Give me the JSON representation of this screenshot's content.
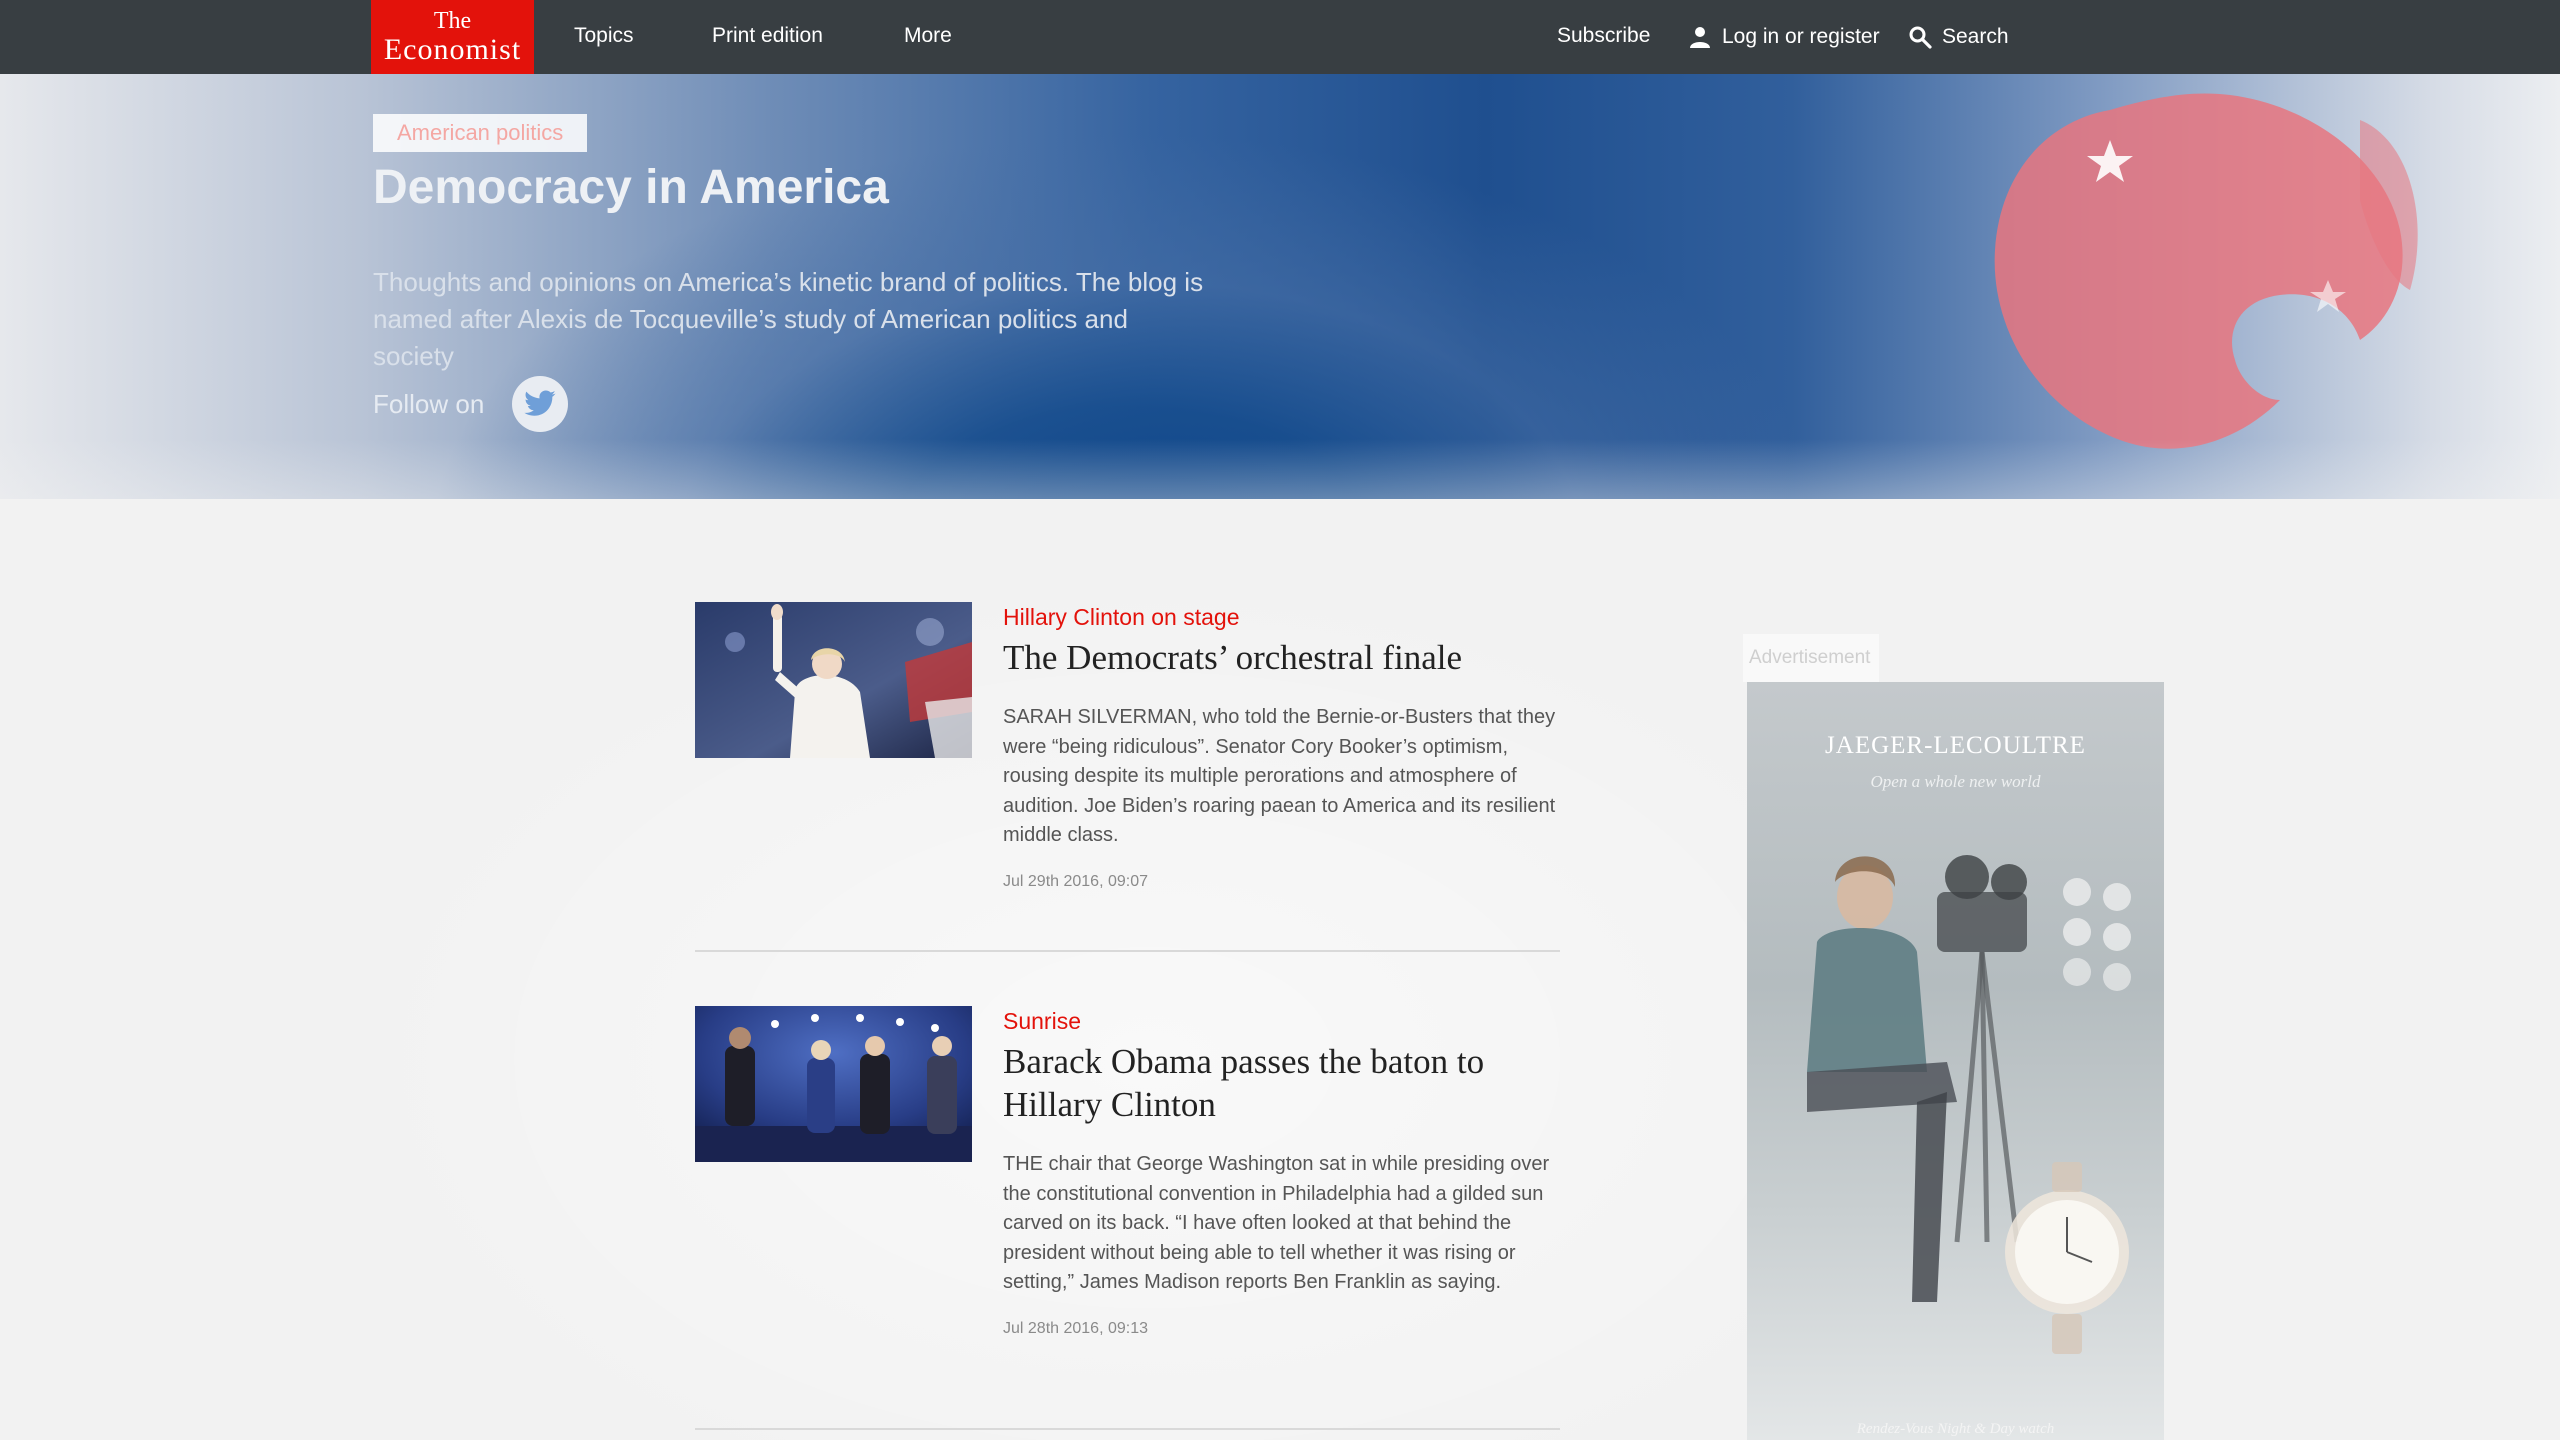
{
  "nav": {
    "logo_line1": "The",
    "logo_line2": "Economist",
    "topics": "Topics",
    "print_edition": "Print edition",
    "more": "More",
    "subscribe": "Subscribe",
    "login": "Log in or register",
    "search": "Search"
  },
  "hero": {
    "tag": "American politics",
    "title": "Democracy in America",
    "description": "Thoughts and opinions on America’s kinetic brand of politics. The blog is named after Alexis de Tocqueville’s study of American politics and society",
    "follow_label": "Follow on"
  },
  "articles": [
    {
      "kicker": "Hillary Clinton on stage",
      "headline": "The Democrats’ orchestral finale",
      "summary": "SARAH SILVERMAN, who told the Bernie-or-Busters that they were “being ridiculous”. Senator Cory Booker’s optimism, rousing despite its multiple perorations and atmosphere of audition. Joe Biden’s roaring paean to America and its resilient middle class.",
      "date": "Jul 29th 2016, 09:07"
    },
    {
      "kicker": "Sunrise",
      "headline": "Barack Obama passes the baton to Hillary Clinton",
      "summary": "THE chair that George Washington sat in while presiding over the constitutional convention in Philadelphia had a gilded sun carved on its back. “I have often looked at that behind the president without being able to tell whether it was rising or setting,” James Madison reports Ben Franklin as saying.",
      "date": "Jul 28th 2016, 09:13"
    }
  ],
  "ad": {
    "label": "Advertisement",
    "brand": "JAEGER-LECOULTRE",
    "tagline": "Open a whole new world",
    "footer": "Rendez-Vous Night & Day watch"
  },
  "colors": {
    "brand_red": "#e3120b",
    "nav_bg": "#383e42",
    "hero_blue": "#0d4488"
  }
}
